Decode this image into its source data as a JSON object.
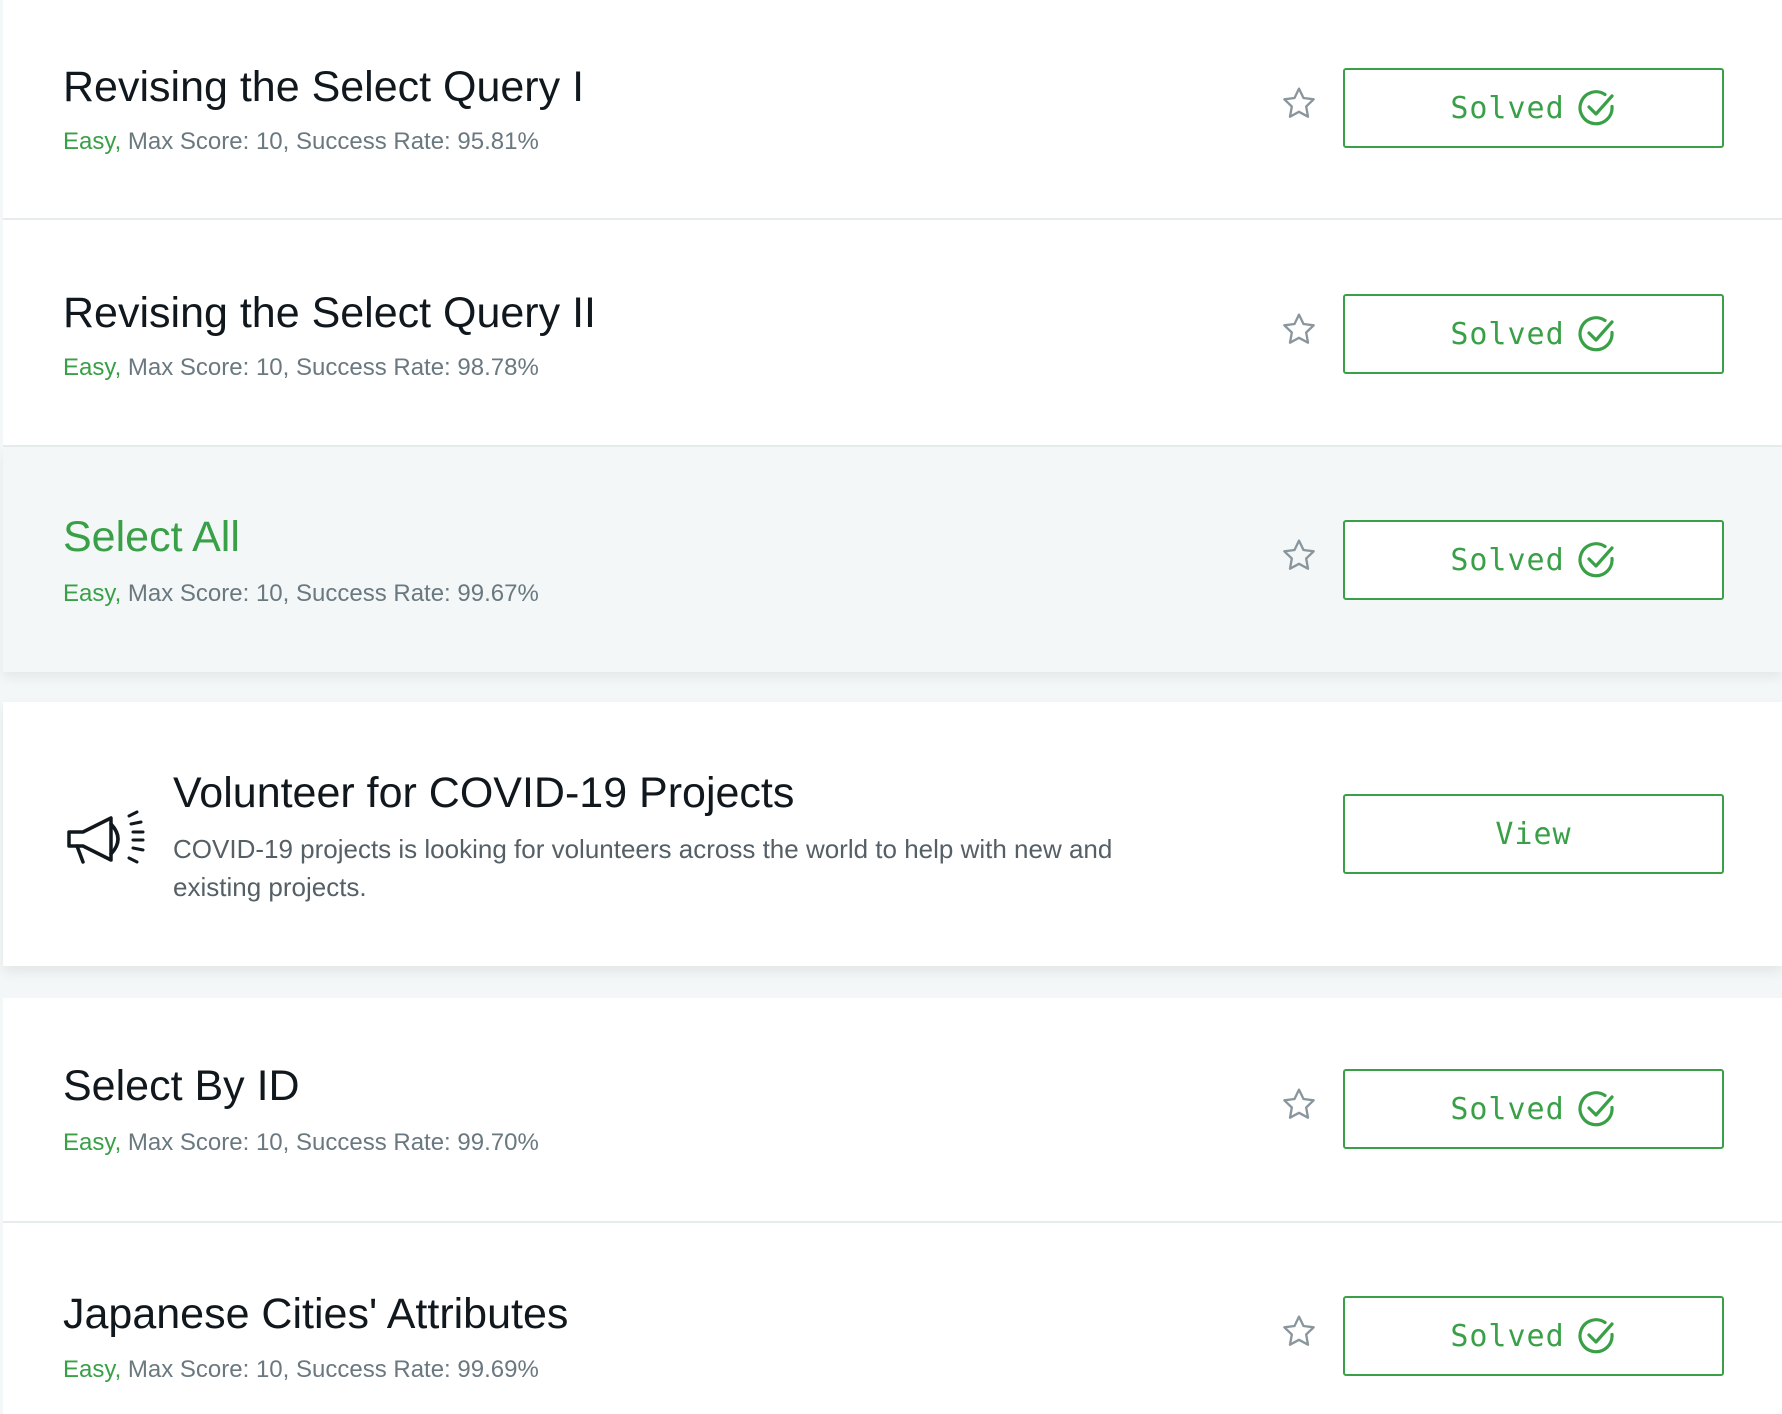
{
  "challenges": [
    {
      "title": "Revising the Select Query I",
      "difficulty": "Easy,",
      "meta": " Max Score: 10, Success Rate: 95.81%",
      "button": "Solved",
      "solved": true
    },
    {
      "title": "Revising the Select Query II",
      "difficulty": "Easy,",
      "meta": " Max Score: 10, Success Rate: 98.78%",
      "button": "Solved",
      "solved": true
    },
    {
      "title": "Select All",
      "difficulty": "Easy,",
      "meta": " Max Score: 10, Success Rate: 99.67%",
      "button": "Solved",
      "solved": true
    },
    {
      "title": "Select By ID",
      "difficulty": "Easy,",
      "meta": " Max Score: 10, Success Rate: 99.70%",
      "button": "Solved",
      "solved": true
    },
    {
      "title": "Japanese Cities' Attributes",
      "difficulty": "Easy,",
      "meta": " Max Score: 10, Success Rate: 99.69%",
      "button": "Solved",
      "solved": true
    }
  ],
  "promo": {
    "title": "Volunteer for COVID-19 Projects",
    "description": "COVID-19 projects is looking for volunteers across the world to help with new and existing projects.",
    "button": "View",
    "icon": "megaphone-icon"
  },
  "colors": {
    "accent": "#39a047",
    "title": "#10181e",
    "meta": "#6a7880",
    "background": "#f3f7f7",
    "card": "#ffffff"
  }
}
